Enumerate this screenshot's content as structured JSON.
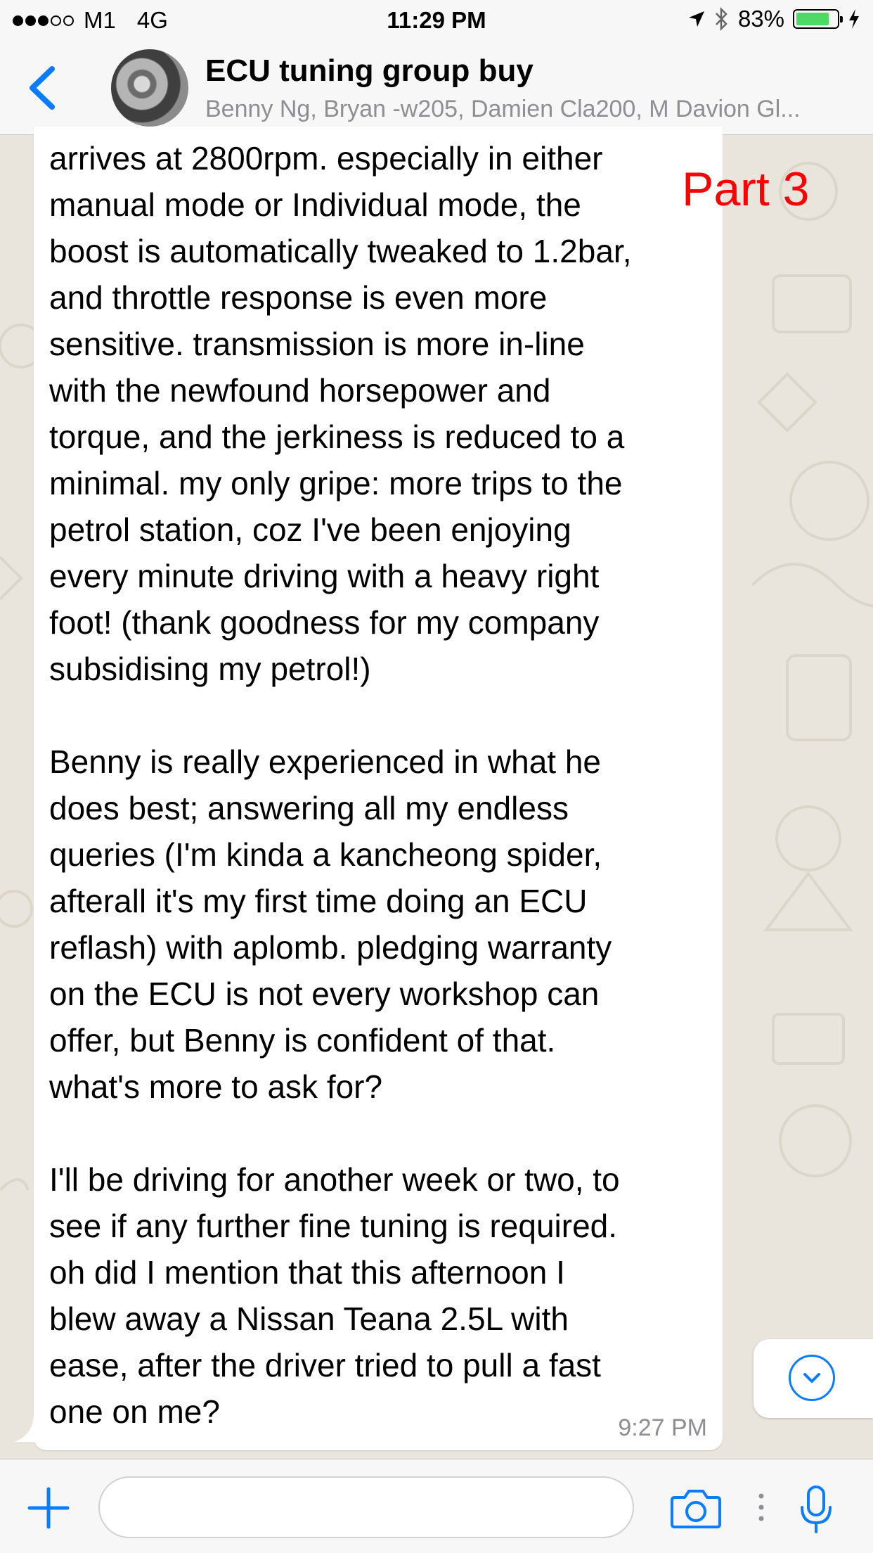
{
  "status_bar": {
    "carrier": "M1",
    "network": "4G",
    "time": "11:29 PM",
    "battery_percent": "83%",
    "battery_level": 0.83,
    "signal_strength": 3,
    "icons": [
      "location-arrow-icon",
      "bluetooth-icon",
      "battery-icon",
      "charging-bolt-icon"
    ]
  },
  "header": {
    "title": "ECU tuning group buy",
    "subtitle": "Benny Ng, Bryan -w205, Damien Cla200, M Davion Gl..."
  },
  "message": {
    "text": "arrives at 2800rpm. especially in either\nmanual mode or Individual mode, the\nboost is automatically tweaked to 1.2bar,\nand throttle response is even more\nsensitive. transmission is more in-line\nwith the newfound horsepower and\ntorque, and the jerkiness is reduced to a\nminimal. my only gripe: more trips to the\npetrol station, coz I've been enjoying\nevery minute driving with a heavy right\nfoot! (thank goodness for my company\nsubsidising my petrol!)\n\nBenny is really experienced in what he\ndoes best; answering all my endless\nqueries (I'm kinda a kancheong spider,\nafterall it's my first time doing an ECU\nreflash) with aplomb. pledging warranty\non the ECU is not every workshop can\noffer, but Benny is confident of that.\nwhat's more to ask for?\n\nI'll be driving for another week or two, to\nsee if any further fine tuning is required.\noh did I mention that this afternoon I\nblew away a Nissan Teana 2.5L with\nease, after the driver tried to pull a fast\none on me?",
    "time": "9:27 PM"
  },
  "annotation": {
    "text": "Part 3",
    "color": "#ff0000"
  },
  "input": {
    "value": "",
    "placeholder": ""
  },
  "colors": {
    "accent": "#0a7cff",
    "background": "#e9e4dc",
    "bubble": "#ffffff"
  }
}
